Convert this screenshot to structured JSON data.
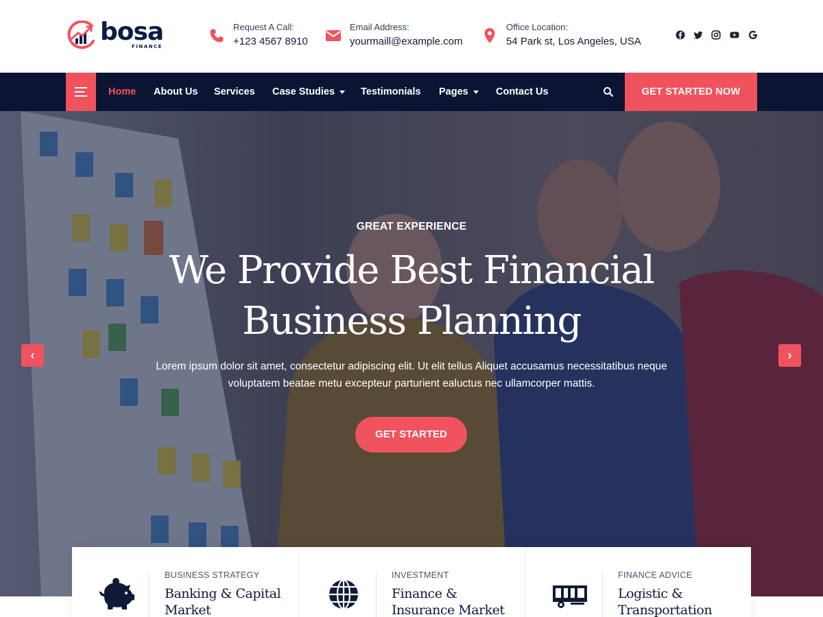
{
  "brand": {
    "name": "bosa",
    "tagline": "FINANCE"
  },
  "contact": {
    "call": {
      "label": "Request A Call:",
      "value": "+123 4567 8910",
      "icon": "phone-icon"
    },
    "email": {
      "label": "Email Address:",
      "value": "yourmaill@example.com",
      "icon": "envelope-icon"
    },
    "location": {
      "label": "Office Location:",
      "value": "54 Park st, Los Angeles, USA",
      "icon": "map-pin-icon"
    }
  },
  "social": [
    "facebook-icon",
    "twitter-icon",
    "instagram-icon",
    "youtube-icon",
    "google-icon"
  ],
  "nav": {
    "items": [
      {
        "label": "Home",
        "active": true
      },
      {
        "label": "About Us"
      },
      {
        "label": "Services"
      },
      {
        "label": "Case Studies",
        "dropdown": true
      },
      {
        "label": "Testimonials"
      },
      {
        "label": "Pages",
        "dropdown": true
      },
      {
        "label": "Contact Us"
      }
    ],
    "cta": "GET STARTED NOW"
  },
  "hero": {
    "subtitle": "GREAT EXPERIENCE",
    "title_line1": "We Provide Best Financial",
    "title_line2": "Business Planning",
    "description_line1": "Lorem ipsum dolor sit amet, consectetur adipiscing elit. Ut elit tellus Aliquet accusamus necessitatibus neque",
    "description_line2": "voluptatem beatae metu excepteur parturient ealuctus nec ullamcorper mattis.",
    "cta": "GET STARTED",
    "prev": "‹",
    "next": "›"
  },
  "features": [
    {
      "category": "BUSINESS STRATEGY",
      "title": "Banking & Capital Market",
      "icon": "piggy-bank-icon"
    },
    {
      "category": "INVESTMENT",
      "title": "Finance & Insurance Market",
      "icon": "globe-icon"
    },
    {
      "category": "FINANCE ADVICE",
      "title": "Logistic & Transportation",
      "icon": "truck-icon"
    }
  ],
  "colors": {
    "accent": "#f0535e",
    "navy": "#0b1533",
    "text": "#0e1a36"
  }
}
